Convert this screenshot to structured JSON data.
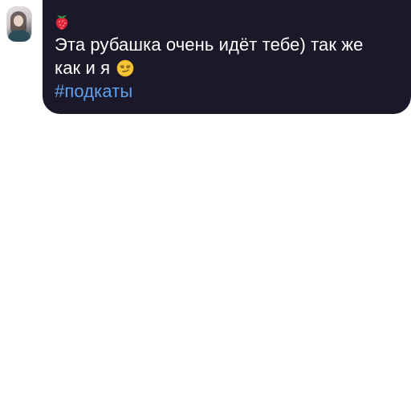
{
  "chat": {
    "reaction_icon": "strawberry-icon",
    "message": {
      "line1": "Эта рубашка очень идёт тебе) так же",
      "line2": "как и я",
      "emoji": "smirking-face-icon",
      "hashtag": "#подкаты"
    }
  },
  "colors": {
    "bubble_bg": "#1b1829",
    "text": "#ffffff",
    "hashtag": "#5ea0ee",
    "page_bg": "#ffffff"
  }
}
